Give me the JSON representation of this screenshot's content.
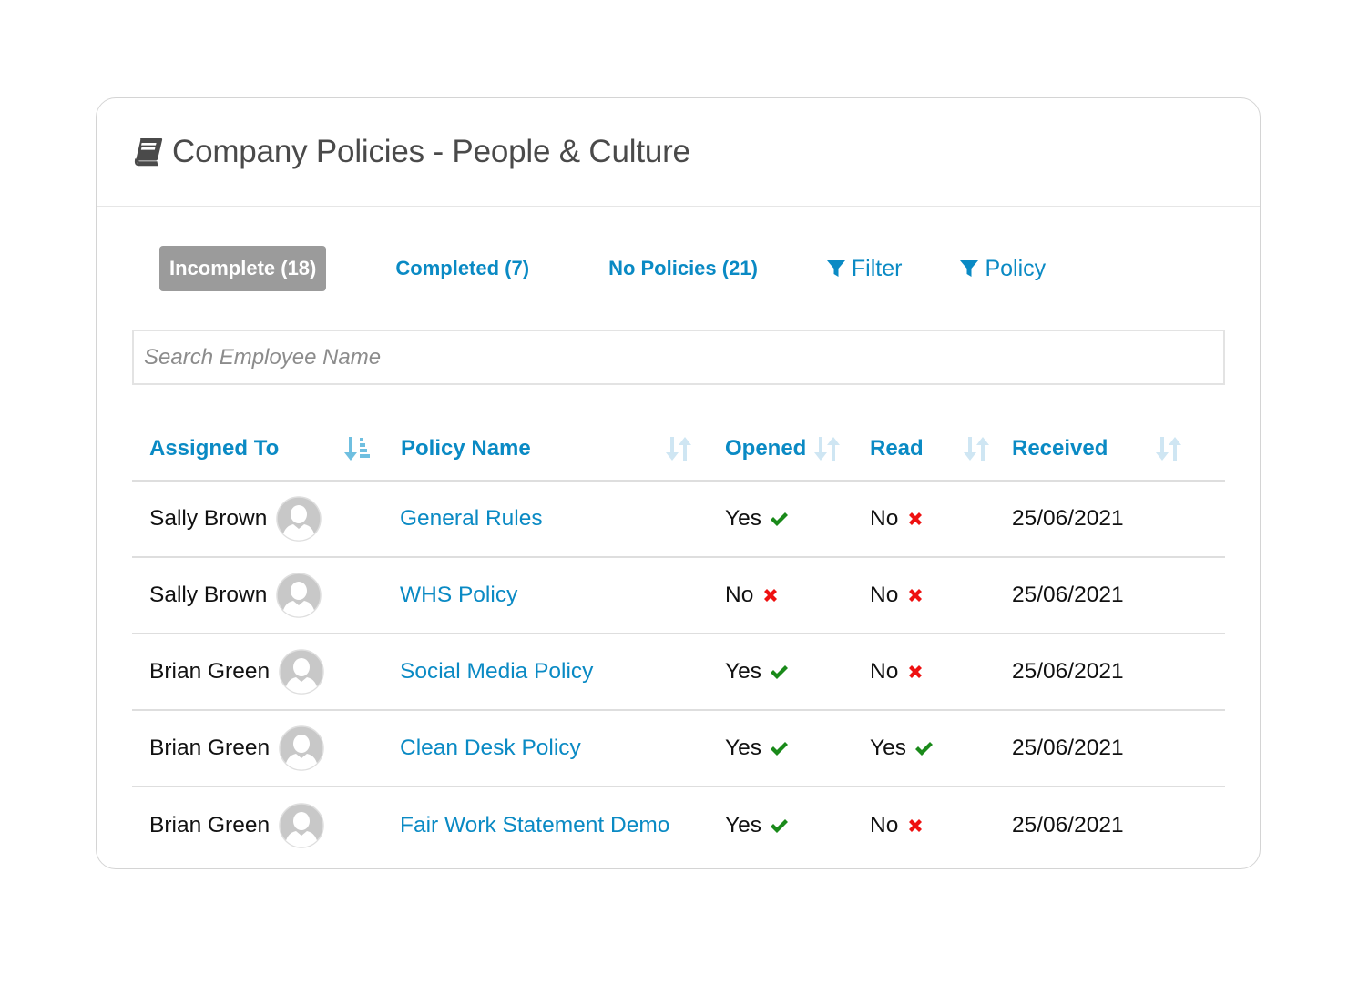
{
  "card": {
    "title": "Company Policies - People & Culture",
    "icon": "book-icon"
  },
  "tabs": [
    {
      "label": "Incomplete (18)",
      "active": true
    },
    {
      "label": "Completed (7)",
      "active": false
    },
    {
      "label": "No Policies (21)",
      "active": false
    }
  ],
  "filters": [
    {
      "label": "Filter",
      "icon": "funnel-icon"
    },
    {
      "label": "Policy",
      "icon": "funnel-icon"
    }
  ],
  "search": {
    "placeholder": "Search Employee Name",
    "value": ""
  },
  "table": {
    "columns": [
      {
        "label": "Assigned To",
        "sort": "descending-active"
      },
      {
        "label": "Policy Name",
        "sort": "unsorted"
      },
      {
        "label": "Opened",
        "sort": "unsorted"
      },
      {
        "label": "Read",
        "sort": "unsorted"
      },
      {
        "label": "Received",
        "sort": "unsorted"
      }
    ],
    "rows": [
      {
        "assigned_to": "Sally Brown",
        "policy": "General Rules",
        "opened": "Yes",
        "read": "No",
        "received": "25/06/2021"
      },
      {
        "assigned_to": "Sally Brown",
        "policy": "WHS Policy",
        "opened": "No",
        "read": "No",
        "received": "25/06/2021"
      },
      {
        "assigned_to": "Brian Green",
        "policy": "Social Media Policy",
        "opened": "Yes",
        "read": "No",
        "received": "25/06/2021"
      },
      {
        "assigned_to": "Brian Green",
        "policy": "Clean Desk Policy",
        "opened": "Yes",
        "read": "Yes",
        "received": "25/06/2021"
      },
      {
        "assigned_to": "Brian Green",
        "policy": "Fair Work Statement Demo",
        "opened": "Yes",
        "read": "No",
        "received": "25/06/2021"
      }
    ]
  },
  "colors": {
    "accent": "#0a8ac4",
    "active_tab_bg": "#9b9b9b",
    "yes": "#1a8a1a",
    "no": "#ee1111"
  }
}
